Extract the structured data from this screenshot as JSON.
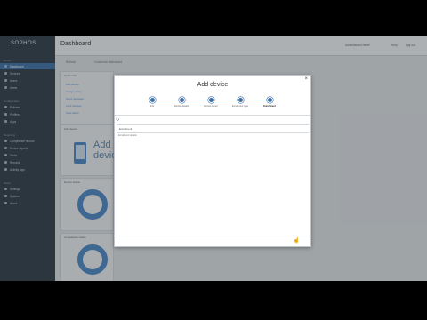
{
  "app": {
    "logo": "SOPHOS",
    "page_title": "Dashboard"
  },
  "header": {
    "user": "Administrator name",
    "help": "Help",
    "logout": "Log out"
  },
  "sidebar": {
    "sections": [
      {
        "label": "Home",
        "items": [
          "Dashboard",
          "Devices",
          "Users",
          "Alerts"
        ]
      },
      {
        "label": "Configuration",
        "items": [
          "Policies",
          "Profiles",
          "Apps"
        ]
      },
      {
        "label": "Reporting",
        "items": [
          "Compliance reports",
          "Device reports",
          "Tasks",
          "Reports",
          "Activity logs"
        ]
      },
      {
        "label": "Setup",
        "items": [
          "Settings",
          "System",
          "About"
        ]
      }
    ]
  },
  "toolbar": {
    "refresh": "Refresh",
    "customize": "Customize dashboard"
  },
  "panels": {
    "quick_links": {
      "title": "Quick links",
      "links": [
        "Add device",
        "Assign policy",
        "Send message",
        "Lock devices",
        "View alerts"
      ]
    },
    "add_device": {
      "title": "Add device",
      "big_label": "Add device"
    },
    "device_status": {
      "title": "Device status"
    },
    "compliance": {
      "title": "Compliance status"
    }
  },
  "modal": {
    "title": "Add device",
    "close": "×",
    "steps": [
      {
        "label": "Info",
        "active": false
      },
      {
        "label": "Device details",
        "active": false
      },
      {
        "label": "Device owner",
        "active": false
      },
      {
        "label": "Enrollment type",
        "active": false
      },
      {
        "label": "Enrollment",
        "active": true
      }
    ],
    "refresh_icon": "↻",
    "list_header": "Enrollment",
    "list_item": "Enrollment details",
    "cursor": "☝"
  }
}
